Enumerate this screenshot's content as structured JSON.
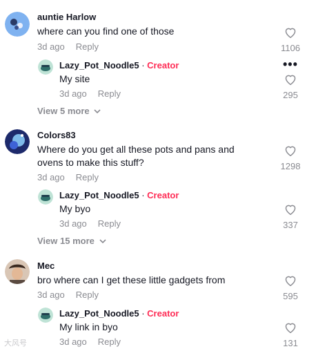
{
  "comments": [
    {
      "username": "auntie Harlow",
      "text": "where can you find one of those",
      "age": "3d ago",
      "reply_label": "Reply",
      "likes": "1106",
      "reply": {
        "username": "Lazy_Pot_Noodle",
        "badge": "5",
        "role": "Creator",
        "text": "My site",
        "age": "3d ago",
        "reply_label": "Reply",
        "likes": "295"
      },
      "view_more": "View 5 more"
    },
    {
      "username": "Colors83",
      "text_lines": [
        "Where do you get all these pots and pans and",
        "ovens to make this stuff?"
      ],
      "age": "3d ago",
      "reply_label": "Reply",
      "likes": "1298",
      "reply": {
        "username": "Lazy_Pot_Noodle",
        "badge": "5",
        "role": "Creator",
        "text": "My byo",
        "age": "3d ago",
        "reply_label": "Reply",
        "likes": "337"
      },
      "view_more": "View 15 more"
    },
    {
      "username": "Mec",
      "text": "bro where can I get these little gadgets from",
      "age": "3d ago",
      "reply_label": "Reply",
      "likes": "595",
      "reply": {
        "username": "Lazy_Pot_Noodle",
        "badge": "5",
        "role": "Creator",
        "text": "My link in byo",
        "age": "3d ago",
        "reply_label": "Reply",
        "likes": "131"
      }
    }
  ],
  "icons": {
    "like": "heart-outline-icon",
    "more": "more-dots-icon",
    "expand": "chevron-down-icon"
  },
  "colors": {
    "creator": "#fe2c55",
    "muted": "#8a8b91",
    "text": "#161823"
  },
  "watermark": "大风号"
}
